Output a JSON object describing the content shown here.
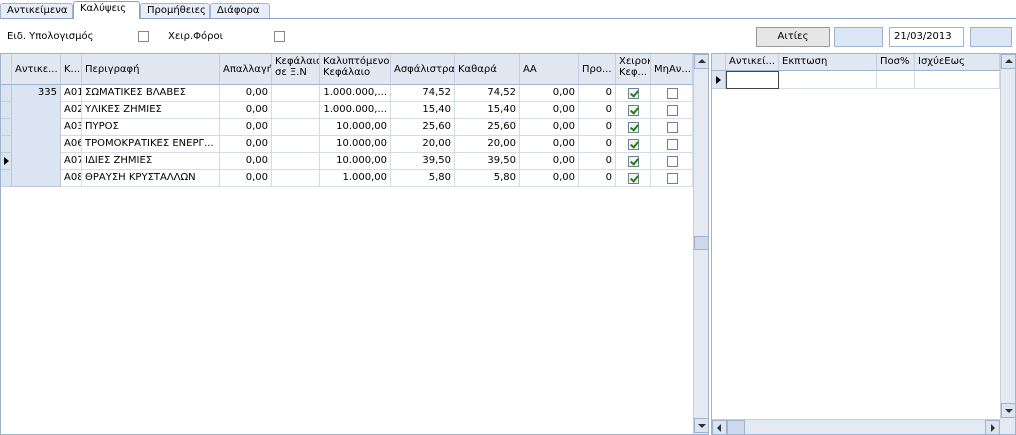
{
  "tabs": [
    "Αντικείμενα",
    "Καλύψεις",
    "Προμήθειες",
    "Διάφορα"
  ],
  "toolbar": {
    "eid_label": "Ειδ. Υπολογισμός",
    "xeir_label": "Χειρ.Φόροι",
    "aities_button": "Αιτίες",
    "date_value": "21/03/2013"
  },
  "main_grid": {
    "headers": {
      "antikeimeno": "Αντικε...",
      "kodikos": "Κ...",
      "perigrafi": "Περιγραφή",
      "apallagi": "Απαλλαγή",
      "kefalaio_xn_1": "Κεφάλαιο",
      "kefalaio_xn_2": "σε Ξ.Ν",
      "kalyptomeno_1": "Καλυπτόμενο",
      "kalyptomeno_2": "Κεφάλαιο",
      "asfalistra": "Ασφάλιστρα",
      "kathara": "Καθαρά",
      "aa": "ΑΑ",
      "pro": "Προ...",
      "xeirok_1": "Χειροκί",
      "xeirok_2": "Κεφ...",
      "mian": "ΜηΑν..."
    },
    "group_value": "335",
    "rows": [
      {
        "code": "Α01",
        "desc": "ΣΩΜΑΤΙΚΕΣ ΒΛΑΒΕΣ",
        "apallagi": "0,00",
        "kefxn": "",
        "kalypt": "1.000.000,...",
        "asfal": "74,52",
        "kathara": "74,52",
        "aa": "0,00",
        "pro": "0",
        "xeir": true,
        "mian": false
      },
      {
        "code": "Α02",
        "desc": "ΥΛΙΚΕΣ ΖΗΜΙΕΣ",
        "apallagi": "0,00",
        "kefxn": "",
        "kalypt": "1.000.000,...",
        "asfal": "15,40",
        "kathara": "15,40",
        "aa": "0,00",
        "pro": "0",
        "xeir": true,
        "mian": false
      },
      {
        "code": "Α03",
        "desc": "ΠΥΡΟΣ",
        "apallagi": "0,00",
        "kefxn": "",
        "kalypt": "10.000,00",
        "asfal": "25,60",
        "kathara": "25,60",
        "aa": "0,00",
        "pro": "0",
        "xeir": true,
        "mian": false
      },
      {
        "code": "Α06",
        "desc": "ΤΡΟΜΟΚΡΑΤΙΚΕΣ ΕΝΕΡΓ...",
        "apallagi": "0,00",
        "kefxn": "",
        "kalypt": "10.000,00",
        "asfal": "20,00",
        "kathara": "20,00",
        "aa": "0,00",
        "pro": "0",
        "xeir": true,
        "mian": false
      },
      {
        "code": "Α07",
        "desc": "ΙΔΙΕΣ ΖΗΜΙΕΣ",
        "apallagi": "0,00",
        "kefxn": "",
        "kalypt": "10.000,00",
        "asfal": "39,50",
        "kathara": "39,50",
        "aa": "0,00",
        "pro": "0",
        "xeir": true,
        "mian": false
      },
      {
        "code": "Α08",
        "desc": "ΘΡΑΥΣΗ ΚΡΥΣΤΑΛΛΩΝ",
        "apallagi": "0,00",
        "kefxn": "",
        "kalypt": "1.000,00",
        "asfal": "5,80",
        "kathara": "5,80",
        "aa": "0,00",
        "pro": "0",
        "xeir": true,
        "mian": false
      }
    ]
  },
  "side_grid": {
    "headers": {
      "antikei": "Αντικεί...",
      "ekptosi": "Εκπτωση",
      "pos": "Ποσ%",
      "isxyei": "ΙσχύεΕως"
    }
  },
  "icons": {
    "row_pointer": "current-row-arrow-icon",
    "checkbox_checked": "checkbox-checked-icon",
    "scroll_up": "scroll-up-icon",
    "scroll_down": "scroll-down-icon"
  },
  "colors": {
    "header_bg": "#e2e8f2",
    "grid_border": "#9fb3cf",
    "field_bg": "#dbe6f5"
  }
}
